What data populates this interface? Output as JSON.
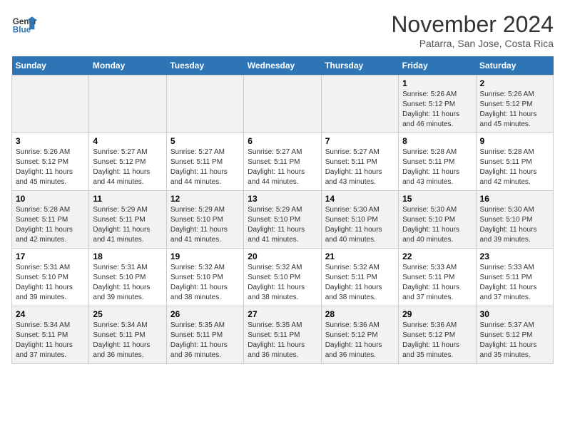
{
  "header": {
    "logo_line1": "General",
    "logo_line2": "Blue",
    "month_title": "November 2024",
    "subtitle": "Patarra, San Jose, Costa Rica"
  },
  "days_of_week": [
    "Sunday",
    "Monday",
    "Tuesday",
    "Wednesday",
    "Thursday",
    "Friday",
    "Saturday"
  ],
  "weeks": [
    [
      {
        "num": "",
        "info": ""
      },
      {
        "num": "",
        "info": ""
      },
      {
        "num": "",
        "info": ""
      },
      {
        "num": "",
        "info": ""
      },
      {
        "num": "",
        "info": ""
      },
      {
        "num": "1",
        "info": "Sunrise: 5:26 AM\nSunset: 5:12 PM\nDaylight: 11 hours\nand 46 minutes."
      },
      {
        "num": "2",
        "info": "Sunrise: 5:26 AM\nSunset: 5:12 PM\nDaylight: 11 hours\nand 45 minutes."
      }
    ],
    [
      {
        "num": "3",
        "info": "Sunrise: 5:26 AM\nSunset: 5:12 PM\nDaylight: 11 hours\nand 45 minutes."
      },
      {
        "num": "4",
        "info": "Sunrise: 5:27 AM\nSunset: 5:12 PM\nDaylight: 11 hours\nand 44 minutes."
      },
      {
        "num": "5",
        "info": "Sunrise: 5:27 AM\nSunset: 5:11 PM\nDaylight: 11 hours\nand 44 minutes."
      },
      {
        "num": "6",
        "info": "Sunrise: 5:27 AM\nSunset: 5:11 PM\nDaylight: 11 hours\nand 44 minutes."
      },
      {
        "num": "7",
        "info": "Sunrise: 5:27 AM\nSunset: 5:11 PM\nDaylight: 11 hours\nand 43 minutes."
      },
      {
        "num": "8",
        "info": "Sunrise: 5:28 AM\nSunset: 5:11 PM\nDaylight: 11 hours\nand 43 minutes."
      },
      {
        "num": "9",
        "info": "Sunrise: 5:28 AM\nSunset: 5:11 PM\nDaylight: 11 hours\nand 42 minutes."
      }
    ],
    [
      {
        "num": "10",
        "info": "Sunrise: 5:28 AM\nSunset: 5:11 PM\nDaylight: 11 hours\nand 42 minutes."
      },
      {
        "num": "11",
        "info": "Sunrise: 5:29 AM\nSunset: 5:11 PM\nDaylight: 11 hours\nand 41 minutes."
      },
      {
        "num": "12",
        "info": "Sunrise: 5:29 AM\nSunset: 5:10 PM\nDaylight: 11 hours\nand 41 minutes."
      },
      {
        "num": "13",
        "info": "Sunrise: 5:29 AM\nSunset: 5:10 PM\nDaylight: 11 hours\nand 41 minutes."
      },
      {
        "num": "14",
        "info": "Sunrise: 5:30 AM\nSunset: 5:10 PM\nDaylight: 11 hours\nand 40 minutes."
      },
      {
        "num": "15",
        "info": "Sunrise: 5:30 AM\nSunset: 5:10 PM\nDaylight: 11 hours\nand 40 minutes."
      },
      {
        "num": "16",
        "info": "Sunrise: 5:30 AM\nSunset: 5:10 PM\nDaylight: 11 hours\nand 39 minutes."
      }
    ],
    [
      {
        "num": "17",
        "info": "Sunrise: 5:31 AM\nSunset: 5:10 PM\nDaylight: 11 hours\nand 39 minutes."
      },
      {
        "num": "18",
        "info": "Sunrise: 5:31 AM\nSunset: 5:10 PM\nDaylight: 11 hours\nand 39 minutes."
      },
      {
        "num": "19",
        "info": "Sunrise: 5:32 AM\nSunset: 5:10 PM\nDaylight: 11 hours\nand 38 minutes."
      },
      {
        "num": "20",
        "info": "Sunrise: 5:32 AM\nSunset: 5:10 PM\nDaylight: 11 hours\nand 38 minutes."
      },
      {
        "num": "21",
        "info": "Sunrise: 5:32 AM\nSunset: 5:11 PM\nDaylight: 11 hours\nand 38 minutes."
      },
      {
        "num": "22",
        "info": "Sunrise: 5:33 AM\nSunset: 5:11 PM\nDaylight: 11 hours\nand 37 minutes."
      },
      {
        "num": "23",
        "info": "Sunrise: 5:33 AM\nSunset: 5:11 PM\nDaylight: 11 hours\nand 37 minutes."
      }
    ],
    [
      {
        "num": "24",
        "info": "Sunrise: 5:34 AM\nSunset: 5:11 PM\nDaylight: 11 hours\nand 37 minutes."
      },
      {
        "num": "25",
        "info": "Sunrise: 5:34 AM\nSunset: 5:11 PM\nDaylight: 11 hours\nand 36 minutes."
      },
      {
        "num": "26",
        "info": "Sunrise: 5:35 AM\nSunset: 5:11 PM\nDaylight: 11 hours\nand 36 minutes."
      },
      {
        "num": "27",
        "info": "Sunrise: 5:35 AM\nSunset: 5:11 PM\nDaylight: 11 hours\nand 36 minutes."
      },
      {
        "num": "28",
        "info": "Sunrise: 5:36 AM\nSunset: 5:12 PM\nDaylight: 11 hours\nand 36 minutes."
      },
      {
        "num": "29",
        "info": "Sunrise: 5:36 AM\nSunset: 5:12 PM\nDaylight: 11 hours\nand 35 minutes."
      },
      {
        "num": "30",
        "info": "Sunrise: 5:37 AM\nSunset: 5:12 PM\nDaylight: 11 hours\nand 35 minutes."
      }
    ]
  ]
}
